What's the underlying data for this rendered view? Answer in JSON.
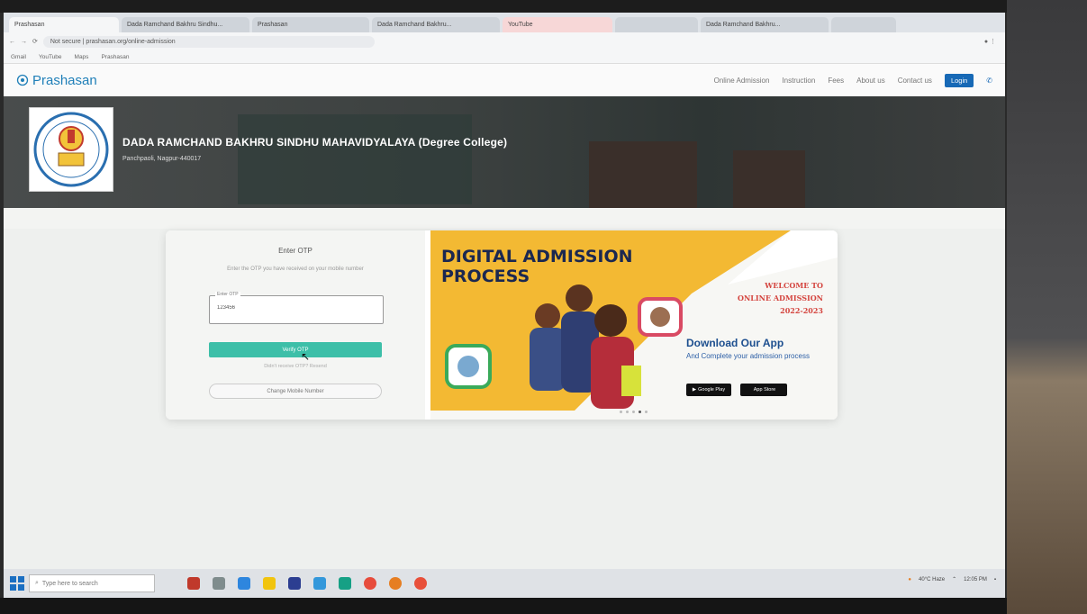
{
  "browser": {
    "tabs": [
      "Prashasan",
      "Dada Ramchand Bakhru Sindhu...",
      "Prashasan",
      "Dada Ramchand Bakhru...",
      "YouTube",
      "",
      "Dada Ramchand Bakhru...",
      ""
    ],
    "url": "Not secure | prashasan.org/online-admission",
    "bookmarks": [
      "Gmail",
      "YouTube",
      "Maps",
      "Prashasan"
    ]
  },
  "site": {
    "logo": "Prashasan",
    "nav": [
      "Online Admission",
      "Instruction",
      "Fees",
      "About us",
      "Contact us"
    ],
    "login": "Login"
  },
  "banner": {
    "college_name": "DADA RAMCHAND BAKHRU SINDHU MAHAVIDYALAYA (Degree College)",
    "address": "Panchpaoli, Nagpur-440017"
  },
  "otp": {
    "title": "Enter OTP",
    "description": "Enter the OTP you have received on your mobile number",
    "field_label": "Enter OTP",
    "field_value": "123456",
    "verify_button": "Verify OTP",
    "resend_text": "Didn't receive OTP? Resend",
    "change_mobile": "Change Mobile Number"
  },
  "promo": {
    "heading_line1": "DIGITAL ADMISSION",
    "heading_line2": "PROCESS",
    "welcome_line1": "WELCOME TO",
    "welcome_line2": "ONLINE ADMISSION",
    "welcome_line3": "2022-2023",
    "download_title": "Download Our App",
    "download_sub": "And Complete your admission process",
    "store_google": "Google Play",
    "store_apple": "App Store"
  },
  "taskbar": {
    "search_placeholder": "Type here to search",
    "weather": "40°C Haze",
    "time": "12:05 PM"
  },
  "colors": {
    "accent": "#3dbfa8",
    "brand": "#1f7fb8",
    "promo_yellow": "#f3b933",
    "heading": "#1b2850",
    "welcome": "#d4453f"
  }
}
